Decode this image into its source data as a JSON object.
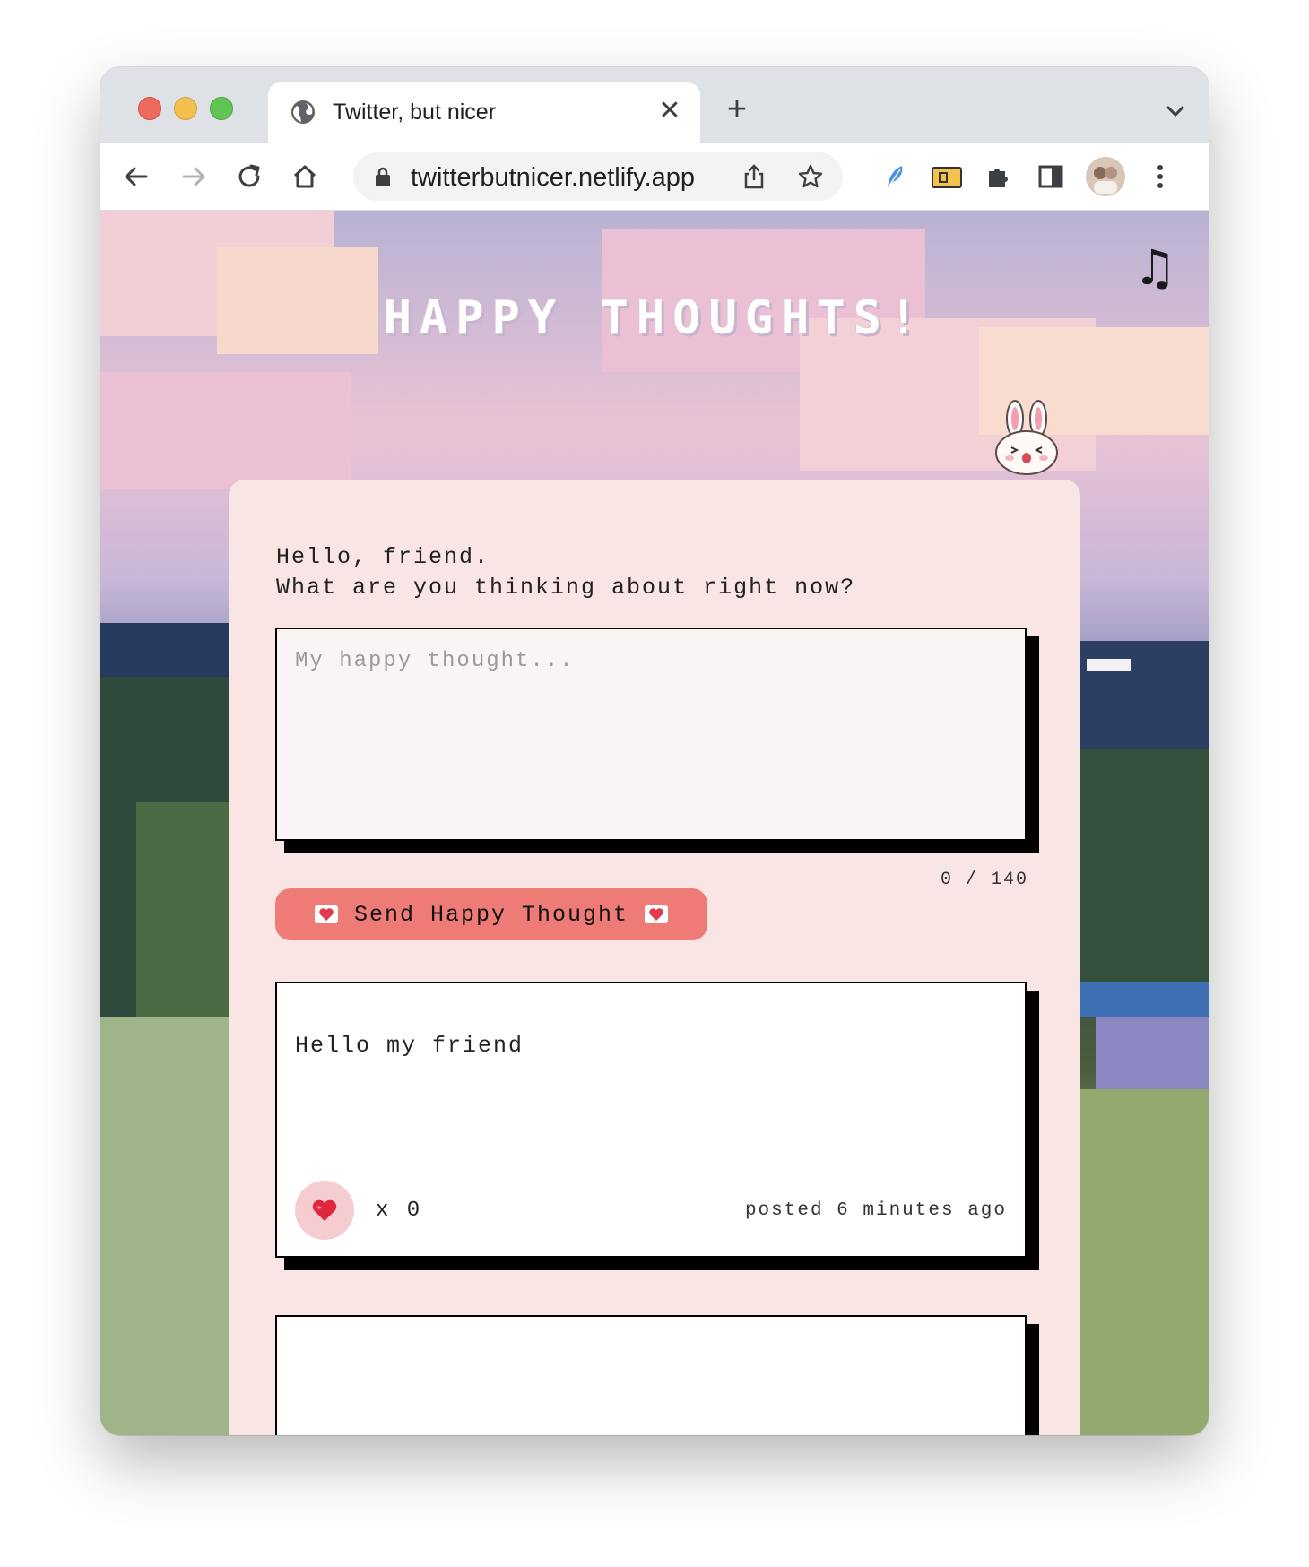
{
  "browser": {
    "tab_title": "Twitter, but nicer",
    "tab_close": "✕",
    "new_tab": "+",
    "url": "twitterbutnicer.netlify.app"
  },
  "page": {
    "music_icon": "♫",
    "title": "HAPPY THOUGHTS!",
    "greeting": "Hello, friend.\nWhat are you thinking about right now?",
    "input_placeholder": "My happy thought...",
    "input_value": "",
    "char_counter": "0 / 140",
    "send_label": "Send Happy Thought",
    "thoughts": [
      {
        "message": "Hello my friend",
        "likes": "x 0",
        "posted": "posted 6 minutes ago"
      },
      {
        "message": "",
        "likes": "",
        "posted": ""
      }
    ]
  },
  "colors": {
    "card_bg": "#fae5e5",
    "button": "#ef7b77",
    "like_bg": "#f5cdd1"
  }
}
